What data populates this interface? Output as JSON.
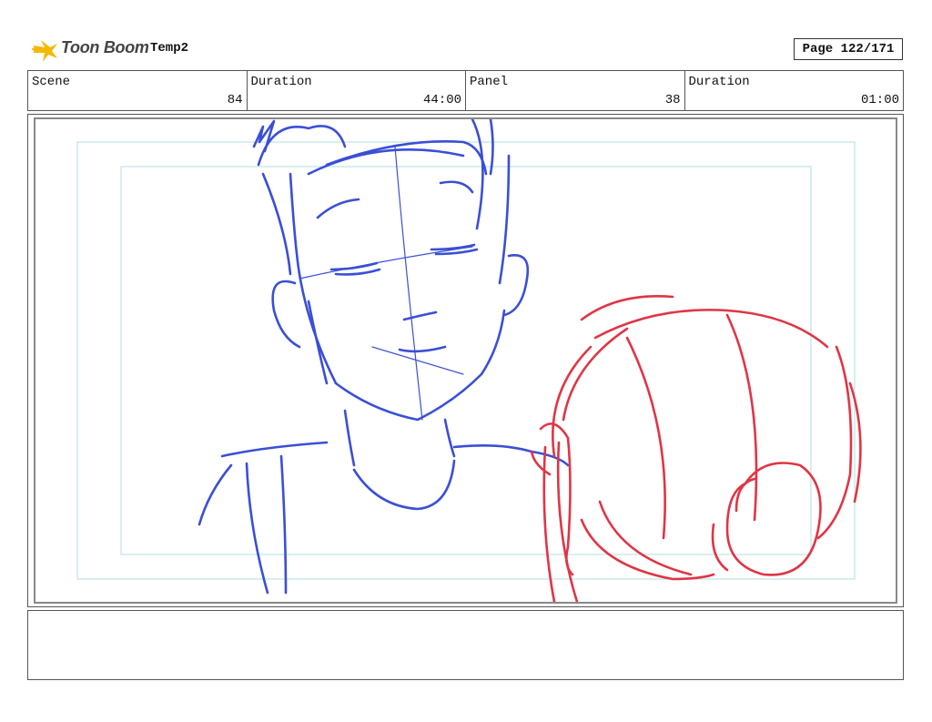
{
  "header": {
    "brand": "Toon Boom",
    "logo_icon": "comet-star-icon",
    "project_name": "Temp2",
    "page_label": "Page 122/171"
  },
  "info": {
    "scene_label": "Scene",
    "scene_value": "84",
    "scene_duration_label": "Duration",
    "scene_duration_value": "44:00",
    "panel_label": "Panel",
    "panel_value": "38",
    "panel_duration_label": "Duration",
    "panel_duration_value": "01:00"
  },
  "panel": {
    "description": "",
    "colors": {
      "character_a": "#3a4fd6",
      "character_b": "#e03545",
      "safe_frame": "#bfe3e6"
    }
  },
  "notes": {
    "text": ""
  }
}
